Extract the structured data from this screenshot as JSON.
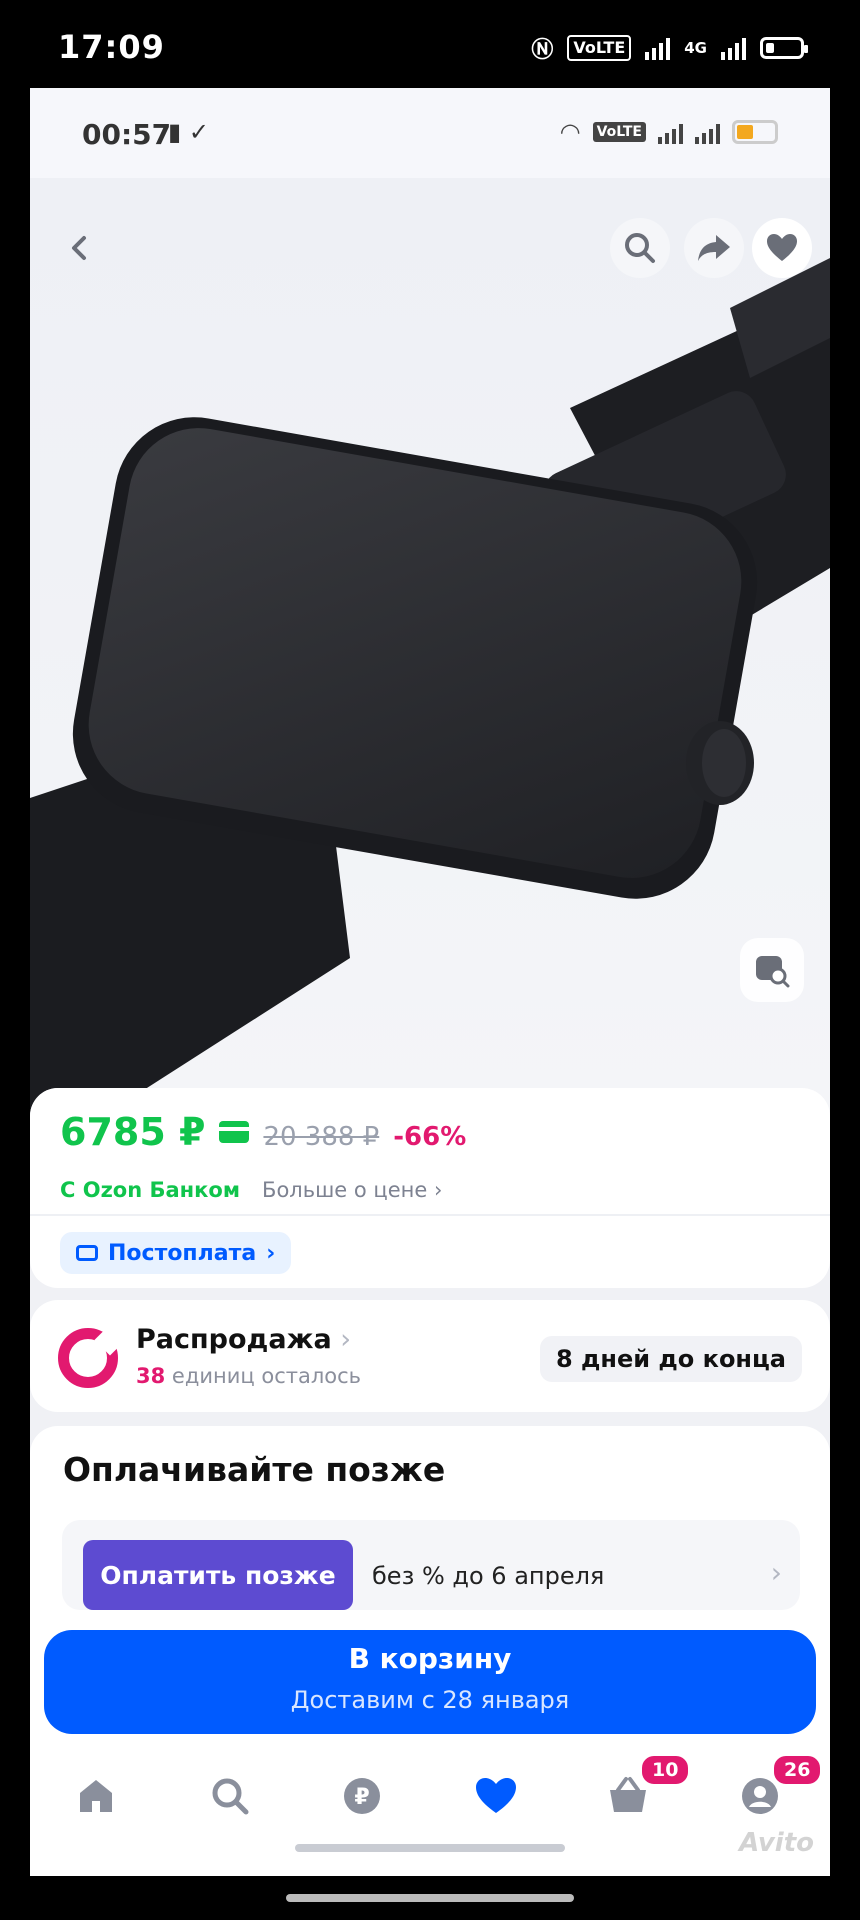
{
  "outer_status": {
    "time": "17:09",
    "network": "4G"
  },
  "inner_status": {
    "time": "00:57",
    "volte": "VoLTE"
  },
  "product_nav": {
    "back": "‹",
    "search": "search",
    "share": "share",
    "favorite": "heart"
  },
  "price": {
    "current": "6785 ₽",
    "old": "20 388 ₽",
    "discount": "-66%",
    "bank_label": "С Ozon Банком",
    "more_link": "Больше о цене"
  },
  "postpay": {
    "label": "Постоплата"
  },
  "sale": {
    "title": "Распродажа",
    "count": "38",
    "remaining_text": " единиц осталось",
    "badge": "8 дней до конца"
  },
  "pay_later": {
    "title": "Оплачивайте позже",
    "button": "Оплатить позже",
    "text": "без % до 6 апреля"
  },
  "cart": {
    "title": "В корзину",
    "delivery": "Доставим с 28 января"
  },
  "bottom_nav": {
    "cart_badge": "10",
    "profile_badge": "26"
  },
  "watermark": "Avito",
  "colors": {
    "ozon_blue": "#005bff",
    "price_green": "#10c44c",
    "sale_pink": "#e2196f",
    "pay_later_purple": "#5d4bd1"
  }
}
